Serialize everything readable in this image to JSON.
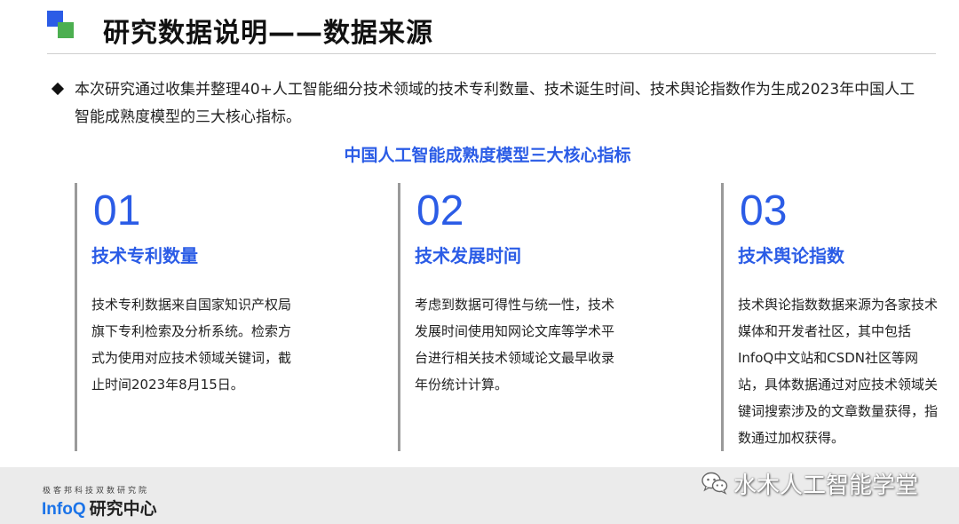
{
  "header": {
    "title": "研究数据说明——数据来源"
  },
  "intro": {
    "text": "本次研究通过收集并整理40+人工智能细分技术领域的技术专利数量、技术诞生时间、技术舆论指数作为生成2023年中国人工智能成熟度模型的三大核心指标。"
  },
  "section": {
    "subtitle": "中国人工智能成熟度模型三大核心指标"
  },
  "columns": [
    {
      "number": "01",
      "heading": "技术专利数量",
      "body": "技术专利数据来自国家知识产权局旗下专利检索及分析系统。检索方式为使用对应技术领域关键词，截止时间2023年8月15日。"
    },
    {
      "number": "02",
      "heading": "技术发展时间",
      "body": "考虑到数据可得性与统一性，技术发展时间使用知网论文库等学术平台进行相关技术领域论文最早收录年份统计计算。"
    },
    {
      "number": "03",
      "heading": "技术舆论指数",
      "body": "技术舆论指数数据来源为各家技术媒体和开发者社区，其中包括InfoQ中文站和CSDN社区等网站，具体数据通过对应技术领域关键词搜索涉及的文章数量获得，指数通过加权获得。"
    }
  ],
  "footer": {
    "tagline": "极客邦科技双数研究院",
    "brand": "InfoQ",
    "brand_suffix": "研究中心"
  },
  "watermark": {
    "icon": "wechat-icon",
    "text": "水木人工智能学堂"
  },
  "colors": {
    "accent_blue": "#2b5ce6",
    "accent_green": "#4caf50"
  }
}
